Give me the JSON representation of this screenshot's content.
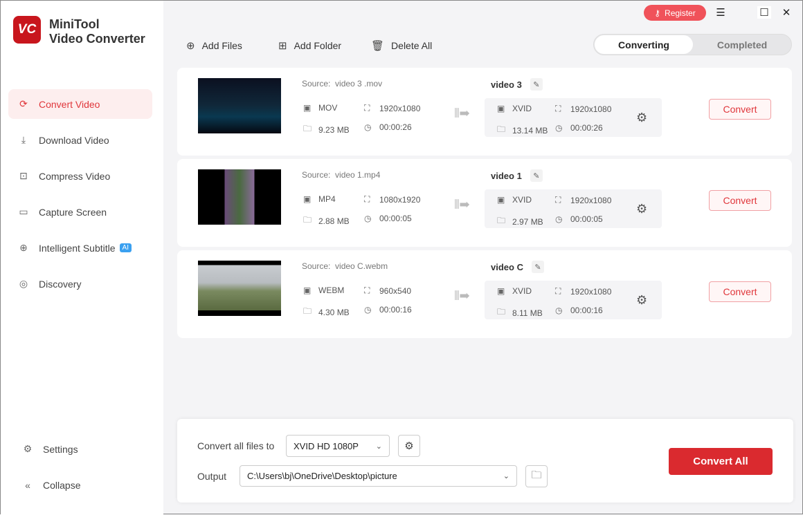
{
  "app": {
    "logo_text": "VC",
    "name_line1": "MiniTool",
    "name_line2": "Video Converter"
  },
  "sidebar": {
    "items": [
      {
        "label": "Convert Video",
        "icon": "convert-icon",
        "glyph": "⟳"
      },
      {
        "label": "Download Video",
        "icon": "download-icon",
        "glyph": "⤓"
      },
      {
        "label": "Compress Video",
        "icon": "compress-icon",
        "glyph": "⊡"
      },
      {
        "label": "Capture Screen",
        "icon": "camera-icon",
        "glyph": "▭"
      },
      {
        "label": "Intelligent Subtitle",
        "icon": "subtitle-icon",
        "glyph": "⊕",
        "badge": "AI"
      },
      {
        "label": "Discovery",
        "icon": "compass-icon",
        "glyph": "◎"
      }
    ],
    "settings": "Settings",
    "collapse": "Collapse"
  },
  "topbar": {
    "register": "Register"
  },
  "toolbar": {
    "add_files": "Add Files",
    "add_folder": "Add Folder",
    "delete_all": "Delete All"
  },
  "tabs": {
    "converting": "Converting",
    "completed": "Completed"
  },
  "files": [
    {
      "source_label": "Source:",
      "source": "video 3 .mov",
      "format": "MOV",
      "resolution": "1920x1080",
      "size": "9.23 MB",
      "duration": "00:00:26",
      "output_name": "video 3",
      "out_format": "XVID",
      "out_resolution": "1920x1080",
      "out_size": "13.14 MB",
      "out_duration": "00:00:26",
      "convert": "Convert",
      "thumb": "linear-gradient(#0b1020,#10283a 50%,#0a3850 70%,#050810)"
    },
    {
      "source_label": "Source:",
      "source": "video 1.mp4",
      "format": "MP4",
      "resolution": "1080x1920",
      "size": "2.88 MB",
      "duration": "00:00:05",
      "output_name": "video 1",
      "out_format": "XVID",
      "out_resolution": "1920x1080",
      "out_size": "2.97 MB",
      "out_duration": "00:00:05",
      "convert": "Convert",
      "thumb": "linear-gradient(90deg,#000 32%,#6a4a7a 32%,#4a6a40 50%,#8a6a9a 68%,#000 68%)"
    },
    {
      "source_label": "Source:",
      "source": "video C.webm",
      "format": "WEBM",
      "resolution": "960x540",
      "size": "4.30 MB",
      "duration": "00:00:16",
      "output_name": "video C",
      "out_format": "XVID",
      "out_resolution": "1920x1080",
      "out_size": "8.11 MB",
      "out_duration": "00:00:16",
      "convert": "Convert",
      "thumb": "linear-gradient(#000 8%,#c8ccd0 8%,#b8bcc0 40%,#7a8a60 55%,#5a6a40 90%,#000 90%)"
    }
  ],
  "bottom": {
    "convert_all_to_label": "Convert all files to",
    "format_value": "XVID HD 1080P",
    "output_label": "Output",
    "output_path": "C:\\Users\\bj\\OneDrive\\Desktop\\picture",
    "convert_all": "Convert All"
  }
}
